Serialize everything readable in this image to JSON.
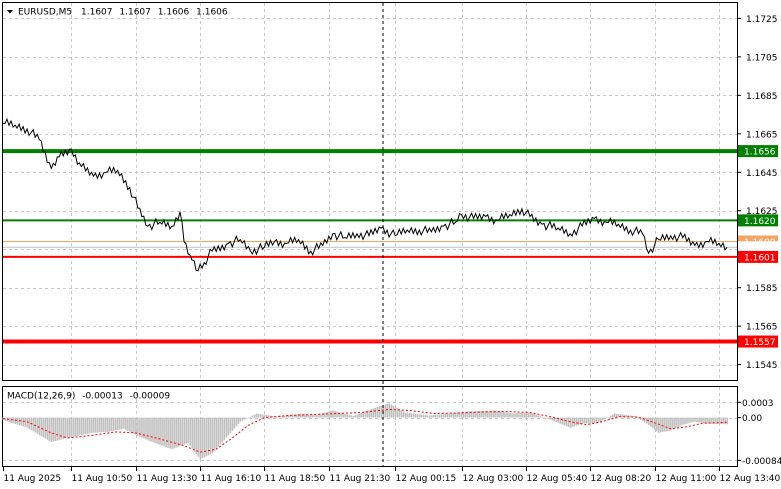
{
  "chart_data": [
    {
      "type": "line",
      "header": {
        "symbol": "EURUSD,M5",
        "open": "1.1607",
        "high": "1.1607",
        "low": "1.1606",
        "close": "1.1606"
      },
      "ylim": [
        1.1537,
        1.1733
      ],
      "y_ticks": [
        "1.1725",
        "1.1705",
        "1.1685",
        "1.1665",
        "1.1645",
        "1.1625",
        "1.1605",
        "1.1585",
        "1.1565",
        "1.1545"
      ],
      "x_ticks": [
        "11 Aug 2025",
        "11 Aug 10:50",
        "11 Aug 13:30",
        "11 Aug 16:10",
        "11 Aug 18:50",
        "11 Aug 21:30",
        "12 Aug 00:15",
        "12 Aug 03:00",
        "12 Aug 05:40",
        "12 Aug 08:20",
        "12 Aug 11:00",
        "12 Aug 13:40"
      ],
      "grid": true,
      "crosshair_x_time": "12 Aug 00:00",
      "price_series": [
        {
          "t": "11 Aug 08:00",
          "p": 1.16705
        },
        {
          "t": "11 Aug 08:30",
          "p": 1.16695
        },
        {
          "t": "11 Aug 09:00",
          "p": 1.16675
        },
        {
          "t": "11 Aug 09:30",
          "p": 1.1662
        },
        {
          "t": "11 Aug 10:00",
          "p": 1.1647
        },
        {
          "t": "11 Aug 10:15",
          "p": 1.1653
        },
        {
          "t": "11 Aug 10:50",
          "p": 1.1657
        },
        {
          "t": "11 Aug 11:15",
          "p": 1.1648
        },
        {
          "t": "11 Aug 11:45",
          "p": 1.1643
        },
        {
          "t": "11 Aug 12:15",
          "p": 1.1645
        },
        {
          "t": "11 Aug 12:45",
          "p": 1.1646
        },
        {
          "t": "11 Aug 13:15",
          "p": 1.1637
        },
        {
          "t": "11 Aug 13:45",
          "p": 1.1622
        },
        {
          "t": "11 Aug 14:00",
          "p": 1.1617
        },
        {
          "t": "11 Aug 14:30",
          "p": 1.1619
        },
        {
          "t": "11 Aug 15:00",
          "p": 1.1617
        },
        {
          "t": "11 Aug 15:20",
          "p": 1.16245
        },
        {
          "t": "11 Aug 15:30",
          "p": 1.1609
        },
        {
          "t": "11 Aug 15:45",
          "p": 1.1602
        },
        {
          "t": "11 Aug 16:00",
          "p": 1.1594
        },
        {
          "t": "11 Aug 16:20",
          "p": 1.1598
        },
        {
          "t": "11 Aug 16:40",
          "p": 1.1604
        },
        {
          "t": "11 Aug 17:20",
          "p": 1.1608
        },
        {
          "t": "11 Aug 17:50",
          "p": 1.161
        },
        {
          "t": "11 Aug 18:15",
          "p": 1.1604
        },
        {
          "t": "11 Aug 18:50",
          "p": 1.1606
        },
        {
          "t": "11 Aug 19:15",
          "p": 1.1609
        },
        {
          "t": "11 Aug 19:45",
          "p": 1.1608
        },
        {
          "t": "11 Aug 20:15",
          "p": 1.161
        },
        {
          "t": "11 Aug 20:45",
          "p": 1.1604
        },
        {
          "t": "11 Aug 21:15",
          "p": 1.1607
        },
        {
          "t": "11 Aug 21:40",
          "p": 1.1613
        },
        {
          "t": "11 Aug 22:10",
          "p": 1.1611
        },
        {
          "t": "11 Aug 22:40",
          "p": 1.1613
        },
        {
          "t": "11 Aug 23:10",
          "p": 1.1612
        },
        {
          "t": "11 Aug 23:40",
          "p": 1.1616
        },
        {
          "t": "12 Aug 00:15",
          "p": 1.1612
        },
        {
          "t": "12 Aug 00:45",
          "p": 1.1615
        },
        {
          "t": "12 Aug 01:15",
          "p": 1.1615
        },
        {
          "t": "12 Aug 01:45",
          "p": 1.1614
        },
        {
          "t": "12 Aug 02:15",
          "p": 1.1617
        },
        {
          "t": "12 Aug 02:45",
          "p": 1.1619
        },
        {
          "t": "12 Aug 03:00",
          "p": 1.1623
        },
        {
          "t": "12 Aug 03:30",
          "p": 1.1621
        },
        {
          "t": "12 Aug 04:00",
          "p": 1.1622
        },
        {
          "t": "12 Aug 04:30",
          "p": 1.162
        },
        {
          "t": "12 Aug 05:00",
          "p": 1.1623
        },
        {
          "t": "12 Aug 05:30",
          "p": 1.1626
        },
        {
          "t": "12 Aug 05:50",
          "p": 1.1622
        },
        {
          "t": "12 Aug 06:20",
          "p": 1.1618
        },
        {
          "t": "12 Aug 07:00",
          "p": 1.1616
        },
        {
          "t": "12 Aug 07:30",
          "p": 1.1613
        },
        {
          "t": "12 Aug 08:00",
          "p": 1.1617
        },
        {
          "t": "12 Aug 08:30",
          "p": 1.1621
        },
        {
          "t": "12 Aug 09:00",
          "p": 1.1619
        },
        {
          "t": "12 Aug 09:30",
          "p": 1.1618
        },
        {
          "t": "12 Aug 10:00",
          "p": 1.1615
        },
        {
          "t": "12 Aug 10:30",
          "p": 1.1613
        },
        {
          "t": "12 Aug 10:45",
          "p": 1.1603
        },
        {
          "t": "12 Aug 11:10",
          "p": 1.161
        },
        {
          "t": "12 Aug 11:40",
          "p": 1.1612
        },
        {
          "t": "12 Aug 12:10",
          "p": 1.1611
        },
        {
          "t": "12 Aug 12:40",
          "p": 1.1607
        },
        {
          "t": "12 Aug 13:10",
          "p": 1.1609
        },
        {
          "t": "12 Aug 13:40",
          "p": 1.1608
        },
        {
          "t": "12 Aug 14:00",
          "p": 1.1606
        }
      ],
      "levels": [
        {
          "label": "1.1656",
          "value": 1.1656,
          "color": "#008000",
          "style": "thick"
        },
        {
          "label": "1.1620",
          "value": 1.162,
          "color": "#008000",
          "style": "thin"
        },
        {
          "label": "1.1609",
          "value": 1.1609,
          "color": "#f4a460",
          "style": "hair"
        },
        {
          "label": "1.1606",
          "value": 1.1606,
          "color": "#c0c0c0",
          "style": "hair"
        },
        {
          "label": "1.1601",
          "value": 1.1601,
          "color": "#ff0000",
          "style": "thin"
        },
        {
          "label": "1.1557",
          "value": 1.1557,
          "color": "#ff0000",
          "style": "thick"
        }
      ]
    },
    {
      "type": "bar",
      "header": {
        "name": "MACD(12,26,9)",
        "macd": "-0.00013",
        "signal": "-0.00009"
      },
      "ylim": [
        -0.00095,
        0.0006
      ],
      "y_ticks": [
        "0.0003",
        "0.00",
        "-0.00084"
      ],
      "hist_color": "#c0c0c0",
      "signal_color": "#ff0000",
      "macd_series": [
        {
          "t": "11 Aug 08:00",
          "v": -5e-05
        },
        {
          "t": "11 Aug 09:00",
          "v": -0.0002
        },
        {
          "t": "11 Aug 10:00",
          "v": -0.00048
        },
        {
          "t": "11 Aug 10:40",
          "v": -0.0004
        },
        {
          "t": "11 Aug 11:40",
          "v": -0.0003
        },
        {
          "t": "11 Aug 12:20",
          "v": -0.00028
        },
        {
          "t": "11 Aug 13:00",
          "v": -0.00022
        },
        {
          "t": "11 Aug 14:00",
          "v": -0.00045
        },
        {
          "t": "11 Aug 15:00",
          "v": -0.00062
        },
        {
          "t": "11 Aug 15:40",
          "v": -0.0005
        },
        {
          "t": "11 Aug 16:10",
          "v": -0.00082
        },
        {
          "t": "11 Aug 16:40",
          "v": -0.0007
        },
        {
          "t": "11 Aug 17:20",
          "v": -0.00035
        },
        {
          "t": "11 Aug 17:50",
          "v": -8e-05
        },
        {
          "t": "11 Aug 18:30",
          "v": 8e-05
        },
        {
          "t": "11 Aug 19:20",
          "v": 2e-05
        },
        {
          "t": "11 Aug 20:20",
          "v": 8e-05
        },
        {
          "t": "11 Aug 21:00",
          "v": 5e-05
        },
        {
          "t": "11 Aug 21:40",
          "v": 0.00014
        },
        {
          "t": "11 Aug 22:30",
          "v": 3e-05
        },
        {
          "t": "11 Aug 23:20",
          "v": 0.00018
        },
        {
          "t": "12 Aug 00:00",
          "v": 0.00028
        },
        {
          "t": "12 Aug 00:40",
          "v": 0.0001
        },
        {
          "t": "12 Aug 01:40",
          "v": 4e-05
        },
        {
          "t": "12 Aug 02:30",
          "v": 8e-05
        },
        {
          "t": "12 Aug 03:20",
          "v": 0.00012
        },
        {
          "t": "12 Aug 04:20",
          "v": 0.00014
        },
        {
          "t": "12 Aug 05:10",
          "v": 8e-05
        },
        {
          "t": "12 Aug 05:50",
          "v": 0.0001
        },
        {
          "t": "12 Aug 06:40",
          "v": -4e-05
        },
        {
          "t": "12 Aug 07:30",
          "v": -0.0002
        },
        {
          "t": "12 Aug 08:00",
          "v": -0.00012
        },
        {
          "t": "12 Aug 08:40",
          "v": -0.0001
        },
        {
          "t": "12 Aug 09:20",
          "v": 8e-05
        },
        {
          "t": "12 Aug 10:10",
          "v": 3e-05
        },
        {
          "t": "12 Aug 10:40",
          "v": -0.00012
        },
        {
          "t": "12 Aug 11:10",
          "v": -0.0003
        },
        {
          "t": "12 Aug 11:40",
          "v": -0.00025
        },
        {
          "t": "12 Aug 12:10",
          "v": -0.00014
        },
        {
          "t": "12 Aug 12:40",
          "v": -8e-05
        },
        {
          "t": "12 Aug 13:10",
          "v": -0.00012
        },
        {
          "t": "12 Aug 14:00",
          "v": -0.00013
        }
      ],
      "signal_series": [
        {
          "t": "11 Aug 08:00",
          "v": -2e-05
        },
        {
          "t": "11 Aug 09:00",
          "v": -8e-05
        },
        {
          "t": "11 Aug 10:00",
          "v": -0.0003
        },
        {
          "t": "11 Aug 10:40",
          "v": -0.0004
        },
        {
          "t": "11 Aug 11:40",
          "v": -0.00035
        },
        {
          "t": "11 Aug 12:40",
          "v": -0.00028
        },
        {
          "t": "11 Aug 13:30",
          "v": -0.0003
        },
        {
          "t": "11 Aug 14:30",
          "v": -0.00042
        },
        {
          "t": "11 Aug 15:30",
          "v": -0.00055
        },
        {
          "t": "11 Aug 16:10",
          "v": -0.00068
        },
        {
          "t": "11 Aug 16:50",
          "v": -0.00062
        },
        {
          "t": "11 Aug 17:30",
          "v": -0.0004
        },
        {
          "t": "11 Aug 18:10",
          "v": -0.00015
        },
        {
          "t": "11 Aug 18:50",
          "v": 0.0
        },
        {
          "t": "11 Aug 19:50",
          "v": 4e-05
        },
        {
          "t": "11 Aug 20:50",
          "v": 6e-05
        },
        {
          "t": "11 Aug 21:50",
          "v": 8e-05
        },
        {
          "t": "11 Aug 22:50",
          "v": 0.0001
        },
        {
          "t": "12 Aug 00:00",
          "v": 0.00016
        },
        {
          "t": "12 Aug 00:50",
          "v": 0.00014
        },
        {
          "t": "12 Aug 01:50",
          "v": 8e-05
        },
        {
          "t": "12 Aug 02:50",
          "v": 9e-05
        },
        {
          "t": "12 Aug 03:50",
          "v": 0.00011
        },
        {
          "t": "12 Aug 04:50",
          "v": 0.00012
        },
        {
          "t": "12 Aug 05:50",
          "v": 0.0001
        },
        {
          "t": "12 Aug 06:40",
          "v": 2e-05
        },
        {
          "t": "12 Aug 07:30",
          "v": -8e-05
        },
        {
          "t": "12 Aug 08:10",
          "v": -0.00014
        },
        {
          "t": "12 Aug 08:50",
          "v": -8e-05
        },
        {
          "t": "12 Aug 09:30",
          "v": 2e-05
        },
        {
          "t": "12 Aug 10:20",
          "v": 1e-05
        },
        {
          "t": "12 Aug 11:00",
          "v": -0.0001
        },
        {
          "t": "12 Aug 11:40",
          "v": -0.00022
        },
        {
          "t": "12 Aug 12:20",
          "v": -0.00018
        },
        {
          "t": "12 Aug 13:00",
          "v": -0.00011
        },
        {
          "t": "12 Aug 13:40",
          "v": -0.0001
        },
        {
          "t": "12 Aug 14:00",
          "v": -9e-05
        }
      ]
    }
  ]
}
